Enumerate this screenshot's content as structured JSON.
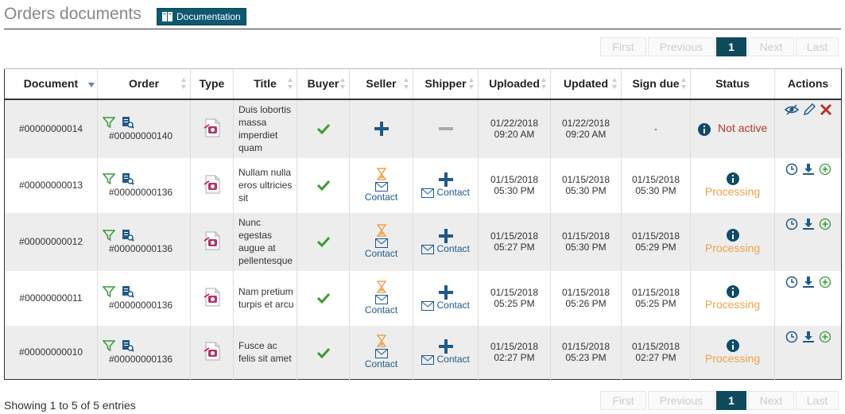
{
  "header": {
    "title": "Orders documents",
    "doc_button": "Documentation"
  },
  "pagination": {
    "first": "First",
    "previous": "Previous",
    "current": "1",
    "next": "Next",
    "last": "Last"
  },
  "table": {
    "headers": [
      "Document",
      "Order",
      "Type",
      "Title",
      "Buyer",
      "Seller",
      "Shipper",
      "Uploaded",
      "Updated",
      "Sign due",
      "Status",
      "Actions"
    ],
    "rows": [
      {
        "document": "#00000000014",
        "order": "#00000000140",
        "title": "Duis lobortis massa imperdiet quam",
        "uploaded_date": "01/22/2018",
        "uploaded_time": "09:20 AM",
        "updated_date": "01/22/2018",
        "updated_time": "09:20 AM",
        "sign_due": "-",
        "status": "Not active"
      },
      {
        "document": "#00000000013",
        "order": "#00000000136",
        "title": "Nullam nulla eros ultricies sit",
        "seller_contact": "Contact",
        "shipper_contact": "Contact",
        "uploaded_date": "01/15/2018",
        "uploaded_time": "05:30 PM",
        "updated_date": "01/15/2018",
        "updated_time": "05:30 PM",
        "sign_due_date": "01/15/2018",
        "sign_due_time": "05:30 PM",
        "status": "Processing"
      },
      {
        "document": "#00000000012",
        "order": "#00000000136",
        "title": "Nunc egestas augue at pellentesque",
        "seller_contact": "Contact",
        "shipper_contact": "Contact",
        "uploaded_date": "01/15/2018",
        "uploaded_time": "05:27 PM",
        "updated_date": "01/15/2018",
        "updated_time": "05:30 PM",
        "sign_due_date": "01/15/2018",
        "sign_due_time": "05:29 PM",
        "status": "Processing"
      },
      {
        "document": "#00000000011",
        "order": "#00000000136",
        "title": "Nam pretium turpis et arcu",
        "seller_contact": "Contact",
        "shipper_contact": "Contact",
        "uploaded_date": "01/15/2018",
        "uploaded_time": "05:25 PM",
        "updated_date": "01/15/2018",
        "updated_time": "05:26 PM",
        "sign_due_date": "01/15/2018",
        "sign_due_time": "05:25 PM",
        "status": "Processing"
      },
      {
        "document": "#00000000010",
        "order": "#00000000136",
        "title": "Fusce ac felis sit amet",
        "seller_contact": "Contact",
        "shipper_contact": "Contact",
        "uploaded_date": "01/15/2018",
        "uploaded_time": "02:27 PM",
        "updated_date": "01/15/2018",
        "updated_time": "05:23 PM",
        "sign_due_date": "01/15/2018",
        "sign_due_time": "02:27 PM",
        "status": "Processing"
      }
    ]
  },
  "footer": {
    "entries": "Showing 1 to 5 of 5 entries"
  },
  "colors": {
    "accent": "#0f5870",
    "check": "#3a9a3a",
    "plus": "#1e5a8a",
    "not_active": "#b23a2c",
    "processing": "#f0a04b",
    "hourglass": "#f0a04b"
  }
}
